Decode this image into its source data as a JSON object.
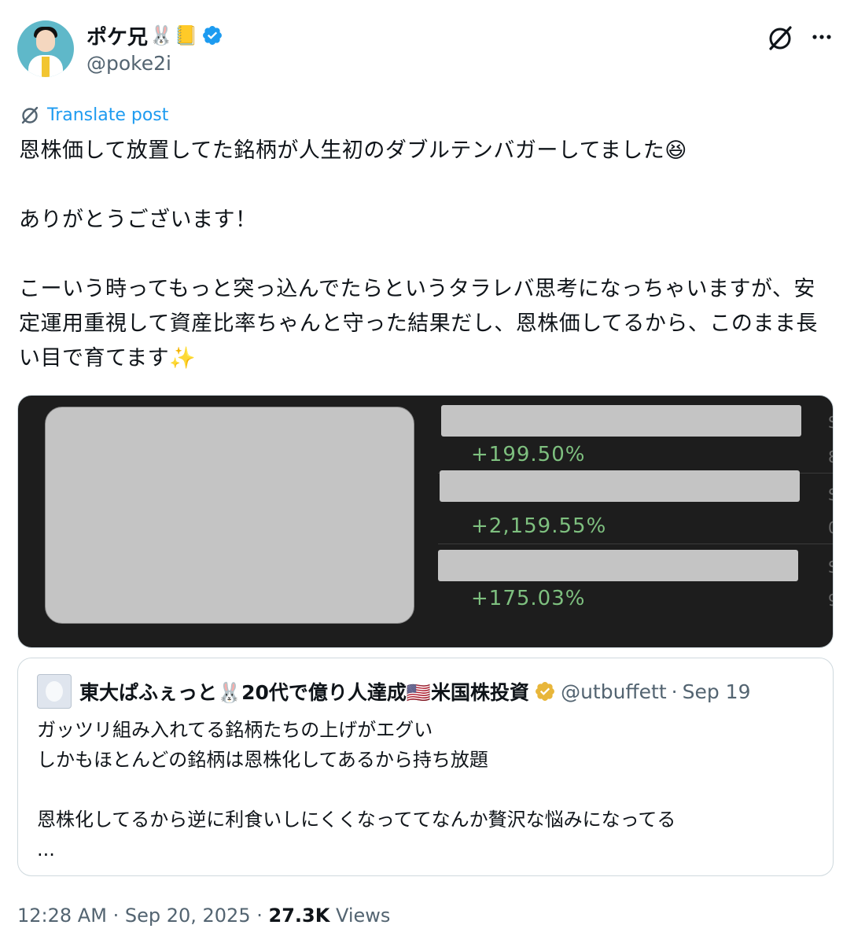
{
  "author": {
    "display_name": "ポケ兄",
    "name_emojis": [
      "🐰",
      "📒"
    ],
    "handle": "@poke2i",
    "verified_color": "#1d9bf0"
  },
  "actions": {
    "grok_icon": "grok-icon",
    "more_icon": "more-icon"
  },
  "translate": {
    "label": "Translate post",
    "link_color": "#1d9bf0"
  },
  "post": {
    "text": "恩株価して放置してた銘柄が人生初のダブルテンバガーしてました😆\n\nありがとうございます！\n\nこーいう時ってもっと突っ込んでたらというタラレバ思考になっちゃいますが、安定運用重視して資産比率ちゃんと守った結果だし、恩株価してるから、このまま長い目で育てます✨"
  },
  "media": {
    "rows": [
      {
        "percent": "+199.50%"
      },
      {
        "percent": "+2,159.55%"
      },
      {
        "percent": "+175.03%"
      }
    ],
    "percent_color": "#7ec07f"
  },
  "quote": {
    "display_name": "東大ぱふぇっと🐰20代で億り人達成🇺🇸米国株投資",
    "badge_color": "#e8b63a",
    "handle": "@utbuffett",
    "date_sep": "·",
    "date": "Sep 19",
    "text": "ガッツリ組み入れてる銘柄たちの上げがエグい\nしかもほとんどの銘柄は恩株化してあるから持ち放題\n\n恩株化してるから逆に利食いしにくくなっててなんか贅沢な悩みになってる\n..."
  },
  "footer": {
    "time": "12:28 AM",
    "sep1": "·",
    "date": "Sep 20, 2025",
    "sep2": "·",
    "views_count": "27.3K",
    "views_label": "Views"
  }
}
